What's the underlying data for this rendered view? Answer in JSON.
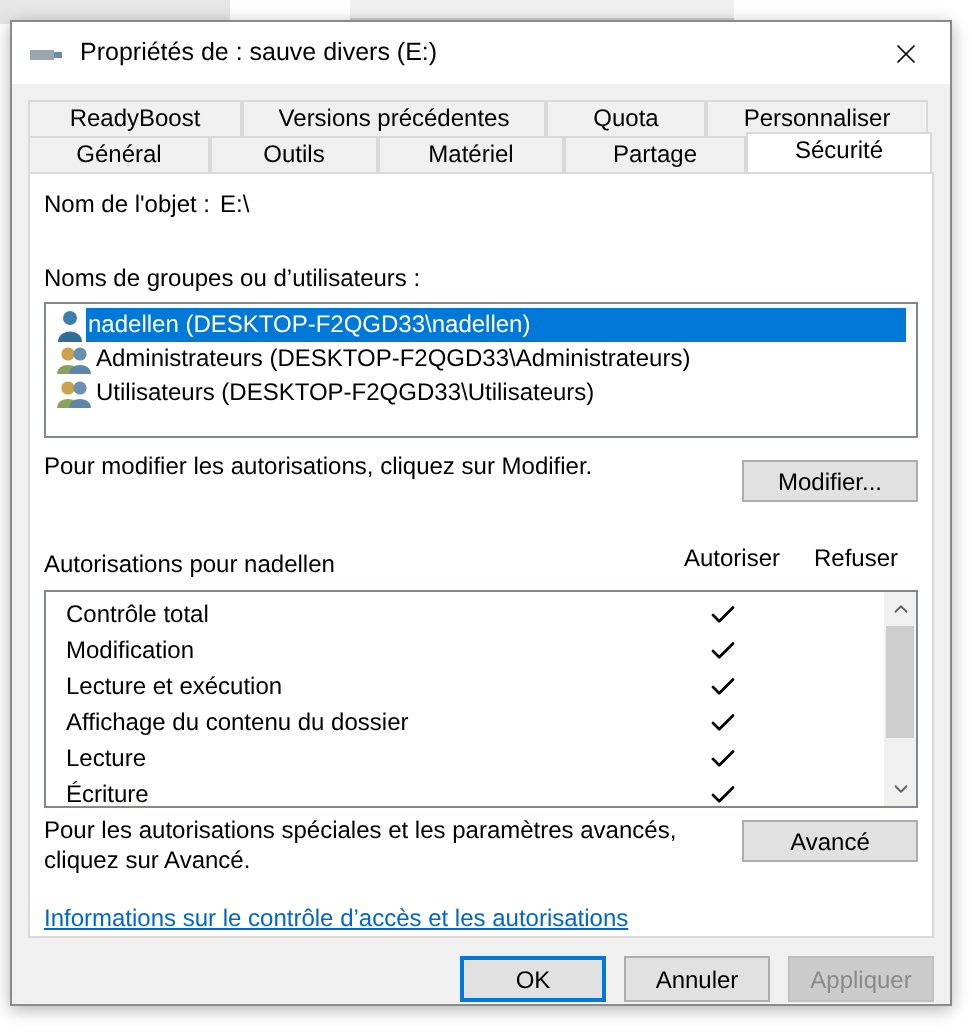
{
  "window": {
    "title": "Propriétés de : sauve divers (E:)"
  },
  "tab_rows": [
    [
      {
        "label": "ReadyBoost",
        "selected": false
      },
      {
        "label": "Versions précédentes",
        "selected": false
      },
      {
        "label": "Quota",
        "selected": false
      },
      {
        "label": "Personnaliser",
        "selected": false
      }
    ],
    [
      {
        "label": "Général",
        "selected": false
      },
      {
        "label": "Outils",
        "selected": false
      },
      {
        "label": "Matériel",
        "selected": false
      },
      {
        "label": "Partage",
        "selected": false
      },
      {
        "label": "Sécurité",
        "selected": true
      }
    ]
  ],
  "object_name": {
    "label": "Nom de l'objet :",
    "value": "E:\\"
  },
  "groups": {
    "label": "Noms de groupes ou d’utilisateurs :",
    "items": [
      {
        "name": "nadellen (DESKTOP-F2QGD33\\nadellen)",
        "kind": "user",
        "selected": true
      },
      {
        "name": "Administrateurs (DESKTOP-F2QGD33\\Administrateurs)",
        "kind": "group",
        "selected": false
      },
      {
        "name": "Utilisateurs (DESKTOP-F2QGD33\\Utilisateurs)",
        "kind": "group",
        "selected": false
      }
    ]
  },
  "modify_hint": "Pour modifier les autorisations, cliquez sur Modifier.",
  "modify_button": "Modifier...",
  "permissions": {
    "title": "Autorisations pour nadellen",
    "columns": [
      "Autoriser",
      "Refuser"
    ],
    "rows": [
      {
        "label": "Contrôle total",
        "allow": true,
        "deny": false
      },
      {
        "label": "Modification",
        "allow": true,
        "deny": false
      },
      {
        "label": "Lecture et exécution",
        "allow": true,
        "deny": false
      },
      {
        "label": "Affichage du contenu du dossier",
        "allow": true,
        "deny": false
      },
      {
        "label": "Lecture",
        "allow": true,
        "deny": false
      },
      {
        "label": "Écriture",
        "allow": true,
        "deny": false
      }
    ]
  },
  "advanced_hint": "Pour les autorisations spéciales et les paramètres avancés, cliquez sur Avancé.",
  "advanced_button": "Avancé",
  "link": "Informations sur le contrôle d’accès et les autorisations",
  "buttons": [
    {
      "label": "OK",
      "default": true,
      "disabled": false
    },
    {
      "label": "Annuler",
      "default": false,
      "disabled": false
    },
    {
      "label": "Appliquer",
      "default": false,
      "disabled": true
    }
  ]
}
